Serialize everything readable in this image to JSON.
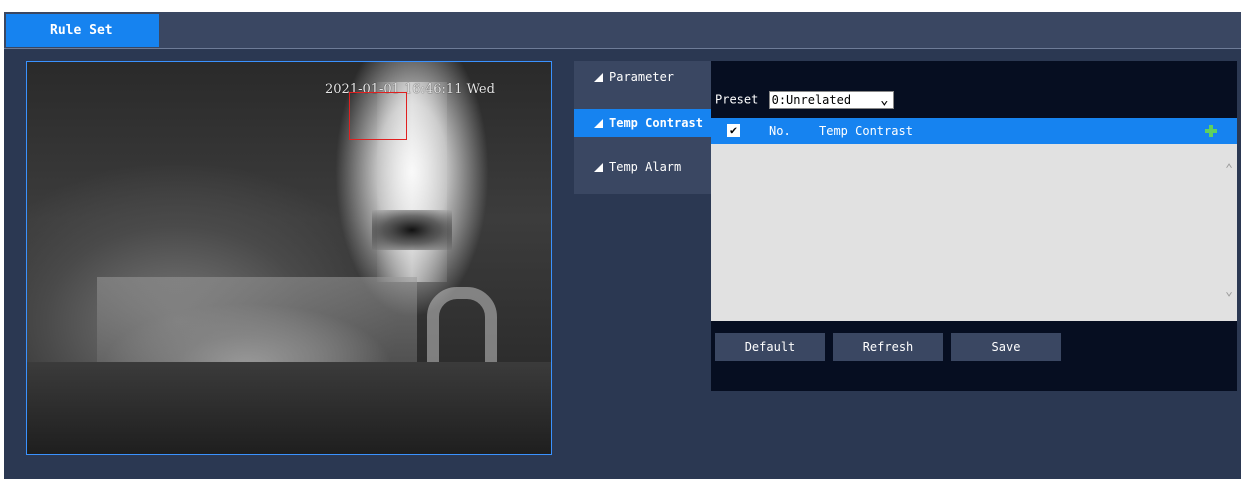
{
  "tabs": {
    "active_label": "Rule Set"
  },
  "video": {
    "osd_timestamp": "2021-01-01 16:46:11 Wed"
  },
  "menu": {
    "items": [
      {
        "label": "Parameter",
        "active": false
      },
      {
        "label": "Temp Contrast",
        "active": true
      },
      {
        "label": "Temp Alarm",
        "active": false
      }
    ]
  },
  "panel": {
    "preset_label": "Preset",
    "preset_value": "0:Unrelated",
    "table": {
      "columns": [
        "No.",
        "Temp Contrast"
      ],
      "rows": []
    },
    "buttons": {
      "default_label": "Default",
      "refresh_label": "Refresh",
      "save_label": "Save"
    }
  },
  "colors": {
    "accent": "#1683f0",
    "background": "#2b3852",
    "panel": "#060e21",
    "add_icon": "#5fd15f",
    "roi_box": "#e02020"
  }
}
